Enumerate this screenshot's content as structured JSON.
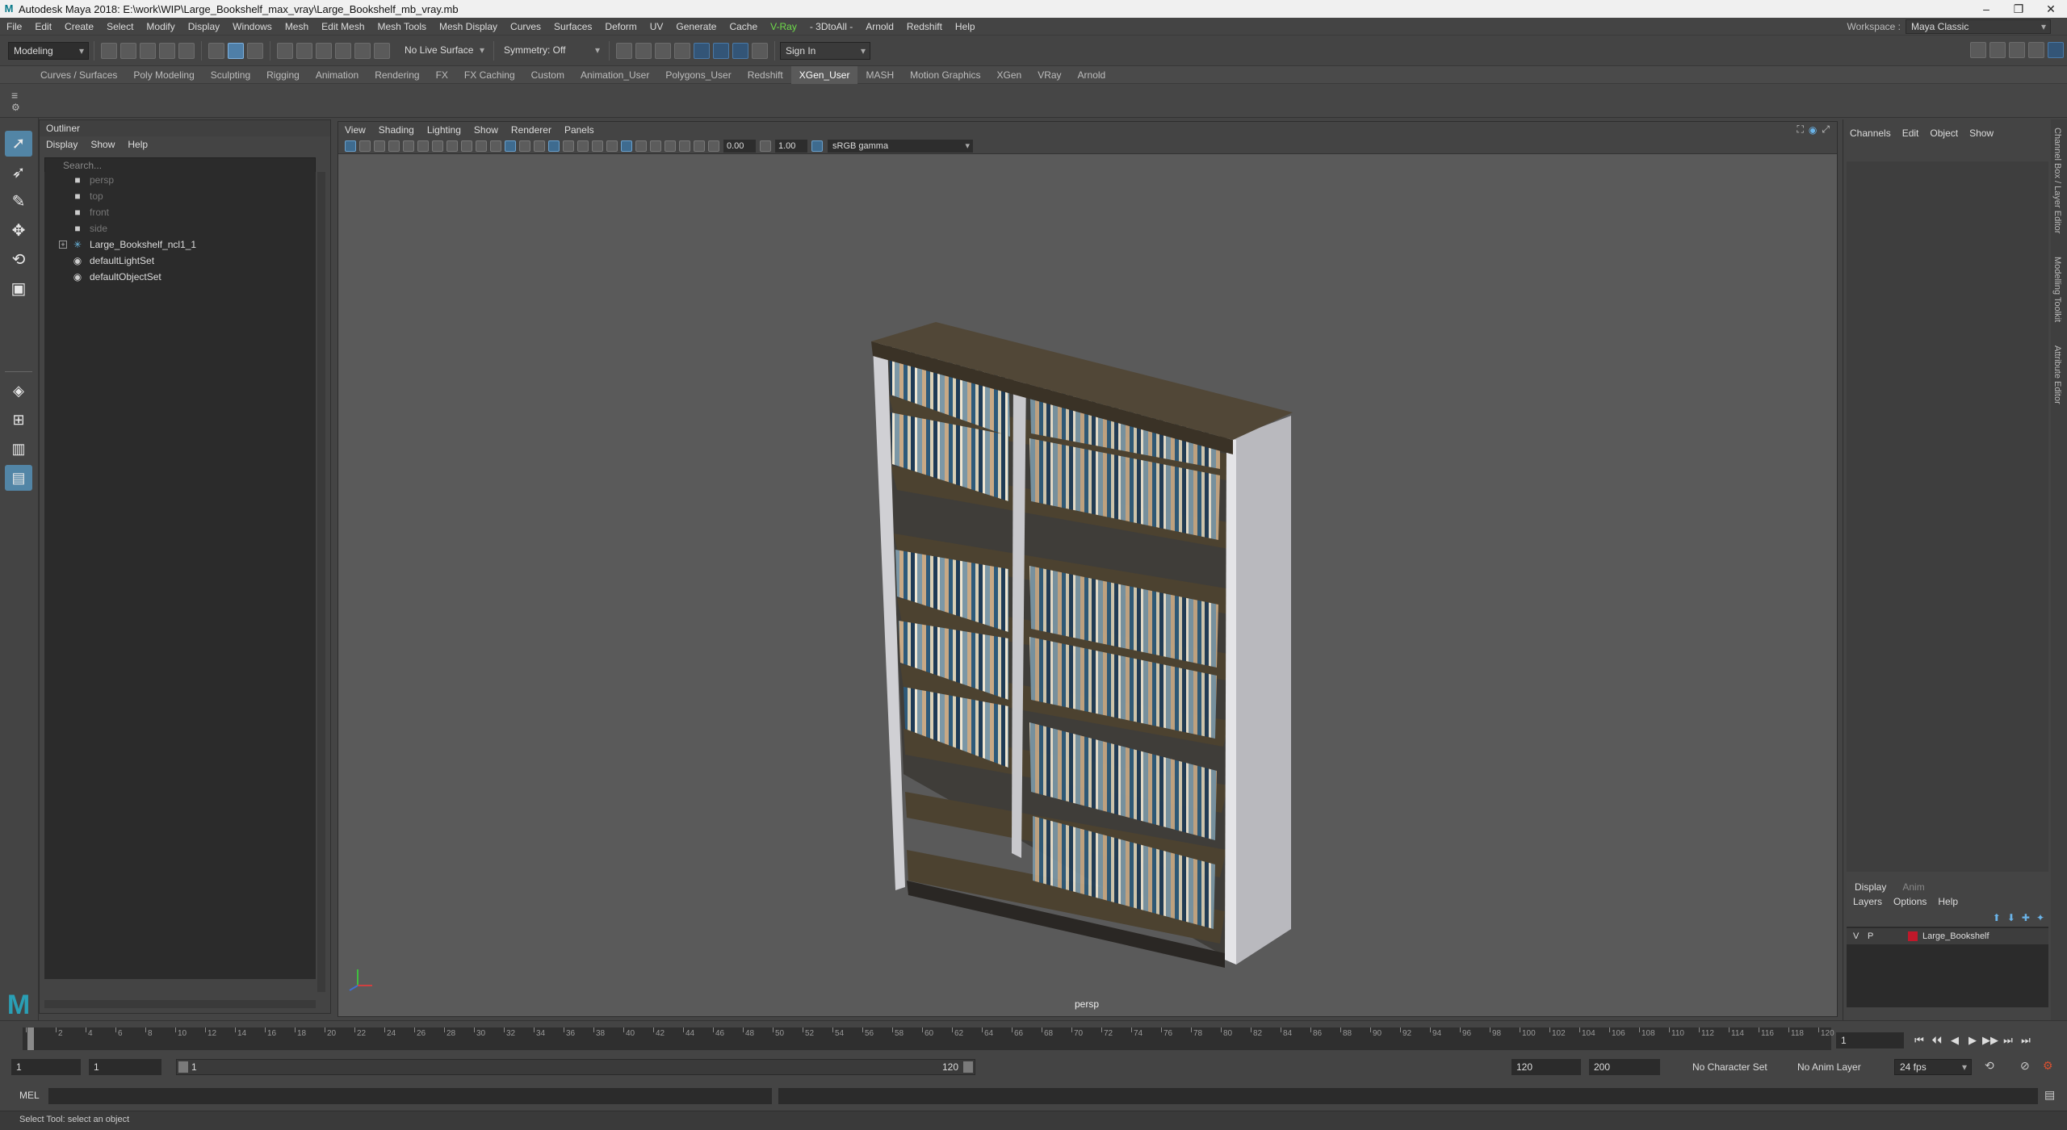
{
  "window": {
    "title": "Autodesk Maya 2018: E:\\work\\WIP\\Large_Bookshelf_max_vray\\Large_Bookshelf_mb_vray.mb",
    "app_letter": "M"
  },
  "menubar": [
    "File",
    "Edit",
    "Create",
    "Select",
    "Modify",
    "Display",
    "Windows",
    "Mesh",
    "Edit Mesh",
    "Mesh Tools",
    "Mesh Display",
    "Curves",
    "Surfaces",
    "Deform",
    "UV",
    "Generate",
    "Cache",
    "V-Ray",
    "- 3DtoAll -",
    "Arnold",
    "Redshift",
    "Help"
  ],
  "workspace": {
    "label": "Workspace :",
    "value": "Maya Classic"
  },
  "statusline": {
    "mode": "Modeling",
    "live_surface": "No Live Surface",
    "symmetry": "Symmetry: Off",
    "sign_in": "Sign In"
  },
  "shelf_tabs": [
    "Curves / Surfaces",
    "Poly Modeling",
    "Sculpting",
    "Rigging",
    "Animation",
    "Rendering",
    "FX",
    "FX Caching",
    "Custom",
    "Animation_User",
    "Polygons_User",
    "Redshift",
    "XGen_User",
    "MASH",
    "Motion Graphics",
    "XGen",
    "VRay",
    "Arnold"
  ],
  "shelf_active": "XGen_User",
  "outliner": {
    "title": "Outliner",
    "menu": [
      "Display",
      "Show",
      "Help"
    ],
    "search_placeholder": "Search...",
    "items": [
      {
        "label": "persp",
        "dim": true
      },
      {
        "label": "top",
        "dim": true
      },
      {
        "label": "front",
        "dim": true
      },
      {
        "label": "side",
        "dim": true
      },
      {
        "label": "Large_Bookshelf_ncl1_1",
        "dim": false
      },
      {
        "label": "defaultLightSet",
        "dim": false
      },
      {
        "label": "defaultObjectSet",
        "dim": false
      }
    ]
  },
  "viewport": {
    "menu": [
      "View",
      "Shading",
      "Lighting",
      "Show",
      "Renderer",
      "Panels"
    ],
    "exposure": "0.00",
    "gamma": "1.00",
    "color_space": "sRGB gamma",
    "camera_label": "persp"
  },
  "channel_box": {
    "menu": [
      "Channels",
      "Edit",
      "Object",
      "Show"
    ]
  },
  "side_tabs": [
    "Channel Box / Layer Editor",
    "Modelling Toolkit",
    "Attribute Editor"
  ],
  "layer_editor": {
    "tabs": [
      "Display",
      "Anim"
    ],
    "menu": [
      "Layers",
      "Options",
      "Help"
    ],
    "layer": {
      "v": "V",
      "p": "P",
      "name": "Large_Bookshelf",
      "color": "#c0182a"
    }
  },
  "timeline": {
    "ticks": [
      "1",
      "2",
      "4",
      "6",
      "8",
      "10",
      "12",
      "14",
      "16",
      "18",
      "20",
      "22",
      "24",
      "26",
      "28",
      "30",
      "32",
      "34",
      "36",
      "38",
      "40",
      "42",
      "44",
      "46",
      "48",
      "50",
      "52",
      "54",
      "56",
      "58",
      "60",
      "62",
      "64",
      "66",
      "68",
      "70",
      "72",
      "74",
      "76",
      "78",
      "80",
      "82",
      "84",
      "86",
      "88",
      "90",
      "92",
      "94",
      "96",
      "98",
      "100",
      "102",
      "104",
      "106",
      "108",
      "110",
      "112",
      "114",
      "116",
      "118",
      "120"
    ],
    "current": "1",
    "playback_glyphs": [
      "⏮",
      "⏴⏴",
      "◀",
      "▶",
      "▶▶",
      "⏭",
      "⏭"
    ]
  },
  "range": {
    "start": "1",
    "inner_start": "1",
    "slider_start": "1",
    "slider_end": "120",
    "end": "120",
    "outer_end": "200",
    "character_set": "No Character Set",
    "anim_layer": "No Anim Layer",
    "fps": "24 fps"
  },
  "command": {
    "label": "MEL"
  },
  "help_line": "Select Tool: select an object",
  "colors": {
    "bg": "#444444",
    "viewport": "#5a5a5a",
    "accent": "#5285a6"
  }
}
